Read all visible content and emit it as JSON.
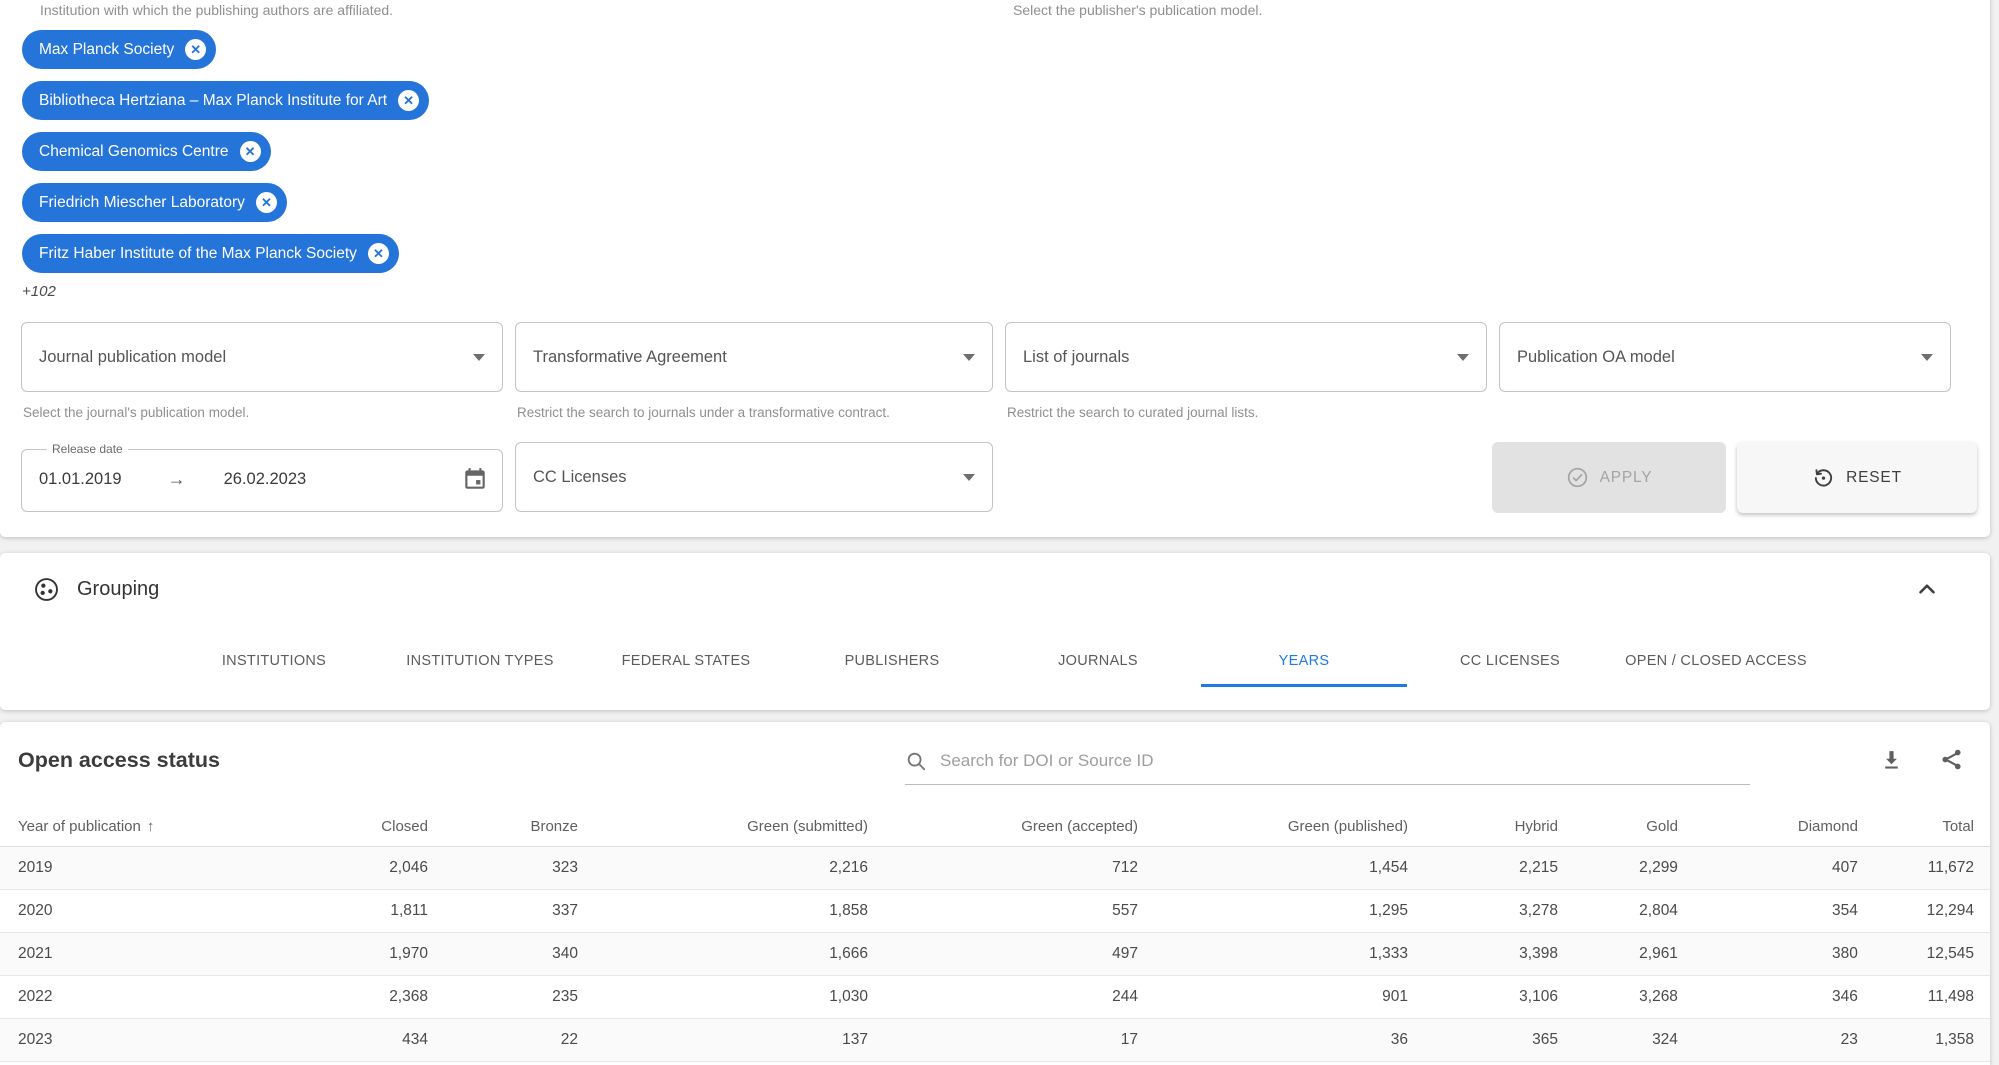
{
  "colors": {
    "accent": "#1d7be1",
    "chip_blue": "#2574d9",
    "page_bg": "#f1f1f1"
  },
  "filter_panel": {
    "institution_helper": "Institution with which the publishing authors are affiliated.",
    "publisher_model_helper": "Select the publisher's publication model.",
    "chips": [
      "Max Planck Society",
      "Bibliotheca Hertziana – Max Planck Institute for Art",
      "Chemical Genomics Centre",
      "Friedrich Miescher Laboratory",
      "Fritz Haber Institute of the Max Planck Society"
    ],
    "more_chips": "+102",
    "selects": [
      {
        "label": "Journal publication model",
        "helper": "Select the journal's publication model."
      },
      {
        "label": "Transformative Agreement",
        "helper": "Restrict the search to journals under a transformative contract."
      },
      {
        "label": "List of journals",
        "helper": "Restrict the search to curated journal lists."
      },
      {
        "label": "Publication OA model",
        "helper": ""
      }
    ],
    "release_date": {
      "label": "Release date",
      "from": "01.01.2019",
      "to": "26.02.2023"
    },
    "cc_licenses_label": "CC Licenses",
    "apply_button": "APPLY",
    "reset_button": "RESET"
  },
  "grouping": {
    "title": "Grouping",
    "tabs": [
      {
        "label": "INSTITUTIONS",
        "active": false
      },
      {
        "label": "INSTITUTION TYPES",
        "active": false
      },
      {
        "label": "FEDERAL STATES",
        "active": false
      },
      {
        "label": "PUBLISHERS",
        "active": false
      },
      {
        "label": "JOURNALS",
        "active": false
      },
      {
        "label": "YEARS",
        "active": true
      },
      {
        "label": "CC LICENSES",
        "active": false
      },
      {
        "label": "OPEN / CLOSED ACCESS",
        "active": false
      }
    ]
  },
  "results": {
    "title": "Open access status",
    "search_placeholder": "Search for DOI or Source ID",
    "sort_column": "Year of publication",
    "sort_direction": "ascending",
    "sort_arrow": "↑",
    "date_arrow": "→",
    "columns": [
      "Year of publication",
      "Closed",
      "Bronze",
      "Green (submitted)",
      "Green (accepted)",
      "Green (published)",
      "Hybrid",
      "Gold",
      "Diamond",
      "Total"
    ],
    "rows": [
      [
        "2019",
        "2,046",
        "323",
        "2,216",
        "712",
        "1,454",
        "2,215",
        "2,299",
        "407",
        "11,672"
      ],
      [
        "2020",
        "1,811",
        "337",
        "1,858",
        "557",
        "1,295",
        "3,278",
        "2,804",
        "354",
        "12,294"
      ],
      [
        "2021",
        "1,970",
        "340",
        "1,666",
        "497",
        "1,333",
        "3,398",
        "2,961",
        "380",
        "12,545"
      ],
      [
        "2022",
        "2,368",
        "235",
        "1,030",
        "244",
        "901",
        "3,106",
        "3,268",
        "346",
        "11,498"
      ],
      [
        "2023",
        "434",
        "22",
        "137",
        "17",
        "36",
        "365",
        "324",
        "23",
        "1,358"
      ]
    ]
  }
}
